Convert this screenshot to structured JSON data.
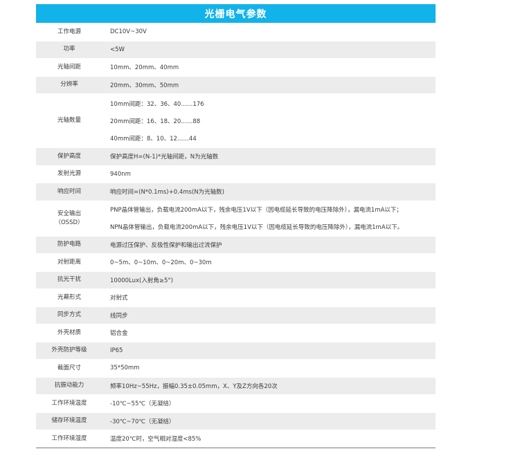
{
  "table": {
    "title": "光栅电气参数",
    "rows": [
      {
        "label": "工作电源",
        "values": [
          "DC10V~30V"
        ]
      },
      {
        "label": "功率",
        "values": [
          "<5W"
        ]
      },
      {
        "label": "光轴间距",
        "values": [
          "10mm、20mm、40mm"
        ]
      },
      {
        "label": "分辨率",
        "values": [
          "20mm、30mm、50mm"
        ]
      },
      {
        "label": "光轴数量",
        "values": [
          "10mm间距：32、36、40……176",
          "20mm间距：16、18、20……88",
          "40mm间距：8、10、12……44"
        ]
      },
      {
        "label": "保护高度",
        "values": [
          "保护高度H=(N-1)*光轴间距，N为光轴数"
        ]
      },
      {
        "label": "发射光源",
        "values": [
          "940nm"
        ]
      },
      {
        "label": "响应时间",
        "values": [
          "响应时间=(N*0.1ms)+0.4ms(N为光轴数)"
        ]
      },
      {
        "label": "安全输出\n（OSSD）",
        "values": [
          "PNP晶体管输出，负载电流200mA以下，残余电压1V以下（因电缆延长导致的电压降除外），漏电流1mA以下；",
          "NPN晶体管输出，负载电流200mA以下，残余电压1V以下（因电缆延长导致的电压降除外），漏电流1mA以下。"
        ]
      },
      {
        "label": "防护电路",
        "values": [
          "电源过压保护、反极性保护和输出过流保护"
        ]
      },
      {
        "label": "对射距离",
        "values": [
          "0~5m、0~10m、0~20m、0~30m"
        ]
      },
      {
        "label": "抗光干扰",
        "values": [
          "10000Lux(入射角≥5°)"
        ]
      },
      {
        "label": "光幕形式",
        "values": [
          "对射式"
        ]
      },
      {
        "label": "同步方式",
        "values": [
          "线同步"
        ]
      },
      {
        "label": "外壳材质",
        "values": [
          "铝合金"
        ]
      },
      {
        "label": "外壳防护等级",
        "values": [
          "IP65"
        ]
      },
      {
        "label": "截面尺寸",
        "values": [
          "35*50mm"
        ]
      },
      {
        "label": "抗振动能力",
        "values": [
          "频率10Hz~55Hz，振幅0.35±0.05mm，X、Y及Z方向各20次"
        ]
      },
      {
        "label": "工作环境温度",
        "values": [
          "-10℃~55℃（无凝结）"
        ]
      },
      {
        "label": "储存环境温度",
        "values": [
          "-30℃~70℃（无凝结）"
        ]
      },
      {
        "label": "工作环境湿度",
        "values": [
          "温度20℃时，空气相对湿度<85%"
        ]
      }
    ]
  },
  "colors": {
    "header_bg": "#12b2ea",
    "header_text": "#ffffff",
    "row_shade": "#ececec",
    "text": "#3a3a3a"
  }
}
